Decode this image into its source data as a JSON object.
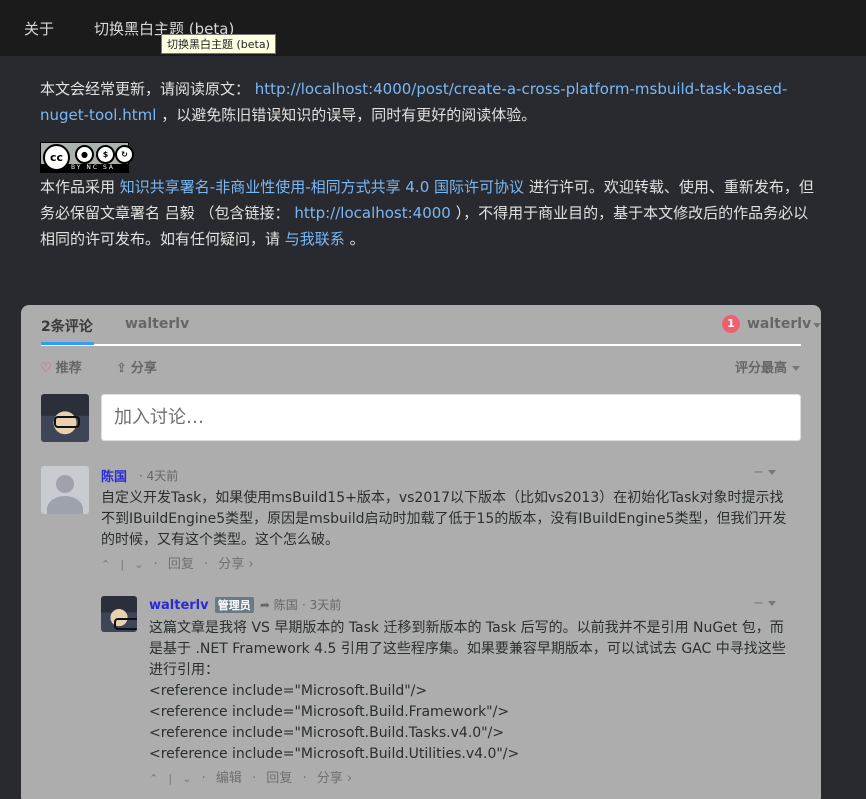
{
  "nav": {
    "about": "关于",
    "theme_toggle": "切换黑白主题 (beta)",
    "tooltip": "切换黑白主题 (beta)"
  },
  "notice": {
    "prefix": "本文会经常更新，请阅读原文：",
    "url": "http://localhost:4000/post/create-a-cross-platform-msbuild-task-based-nuget-tool.html",
    "suffix": "，以避免陈旧错误知识的误导，同时有更好的阅读体验。"
  },
  "cc_badge": {
    "main": "cc",
    "labels": "BY NC SA"
  },
  "license": {
    "prefix": "本作品采用",
    "license_link": "知识共享署名-非商业性使用-相同方式共享 4.0 国际许可协议",
    "mid1": "进行许可。欢迎转载、使用、重新发布，但务必保留文章署名 吕毅 （包含链接：",
    "author_url": "http://localhost:4000",
    "mid2": "），不得用于商业目的，基于本文修改后的作品务必以相同的许可发布。如有任何疑问，请",
    "contact_link": "与我联系",
    "end": "。"
  },
  "comments": {
    "count_tab": "2条评论",
    "site_tab": "walterlv",
    "notification_count": "1",
    "user": "walterlv",
    "recommend": "推荐",
    "share": "分享",
    "sort": "评分最高",
    "placeholder": "加入讨论…",
    "items": [
      {
        "author": "陈国",
        "time": "4天前",
        "body": "自定义开发Task，如果使用msBuild15+版本，vs2017以下版本（比如vs2013）在初始化Task对象时提示找不到IBuildEngine5类型，原因是msbuild启动时加载了低于15的版本，没有IBuildEngine5类型，但我们开发的时候，又有这个类型。这个怎么破。",
        "reply": "回复",
        "share": "分享 ›"
      },
      {
        "author": "walterlv",
        "badge": "管理员",
        "reply_to": "陈国",
        "time": "3天前",
        "body_lines": [
          "这篇文章是我将 VS 早期版本的 Task 迁移到新版本的 Task 后写的。以前我并不是引用 NuGet 包，而是基于 .NET Framework 4.5 引用了这些程序集。如果要兼容早期版本，可以试试去 GAC 中寻找这些进行引用：",
          "<reference include=\"Microsoft.Build\"/>",
          "<reference include=\"Microsoft.Build.Framework\"/>",
          "<reference include=\"Microsoft.Build.Tasks.v4.0\"/>",
          "<reference include=\"Microsoft.Build.Utilities.v4.0\"/>"
        ],
        "edit": "编辑",
        "reply": "回复",
        "share": "分享 ›"
      }
    ]
  }
}
